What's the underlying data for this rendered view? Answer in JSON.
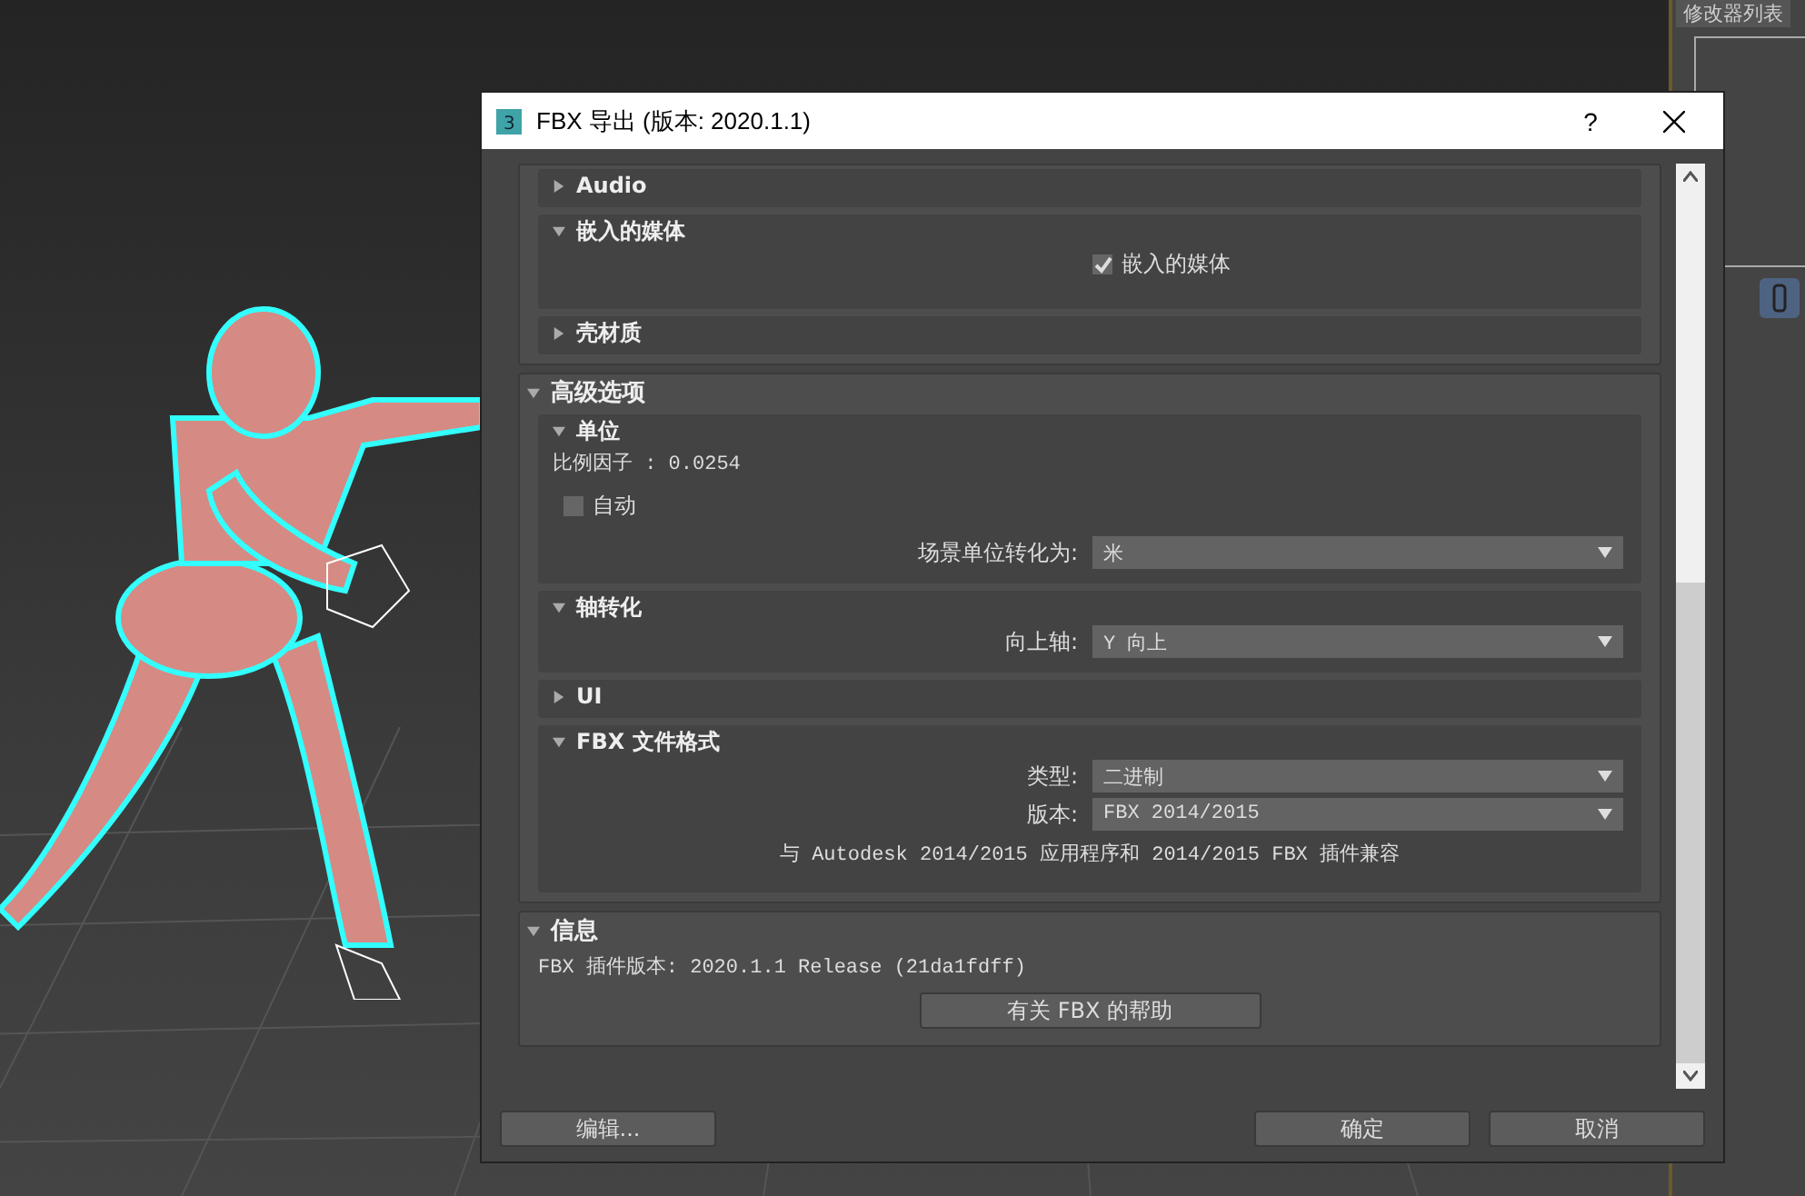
{
  "side_panel": {
    "title": "修改器列表"
  },
  "dialog": {
    "icon_text": "3",
    "title": "FBX 导出 (版本: 2020.1.1)",
    "help": "?"
  },
  "groups": [
    {
      "rollouts": [
        {
          "title": "Audio",
          "expanded": false
        },
        {
          "title": "嵌入的媒体",
          "expanded": true,
          "rows": [
            {
              "kind": "checkbox_field",
              "label": "嵌入的媒体",
              "checked": true
            }
          ]
        },
        {
          "title": "壳材质",
          "expanded": false
        }
      ]
    },
    {
      "title": "高级选项",
      "expanded": true,
      "rollouts": [
        {
          "title": "单位",
          "expanded": true,
          "rows": [
            {
              "kind": "text",
              "text": "比例因子 : 0.0254"
            },
            {
              "kind": "checkbox",
              "label": "自动",
              "checked": false
            },
            {
              "kind": "dropdown",
              "label": "场景单位转化为:",
              "value": "米"
            }
          ]
        },
        {
          "title": "轴转化",
          "expanded": true,
          "rows": [
            {
              "kind": "dropdown",
              "label": "向上轴:",
              "value": "Y 向上"
            }
          ]
        },
        {
          "title": "UI",
          "expanded": false
        },
        {
          "title": "FBX 文件格式",
          "expanded": true,
          "rows": [
            {
              "kind": "dropdown",
              "label": "类型:",
              "value": "二进制"
            },
            {
              "kind": "dropdown",
              "label": "版本:",
              "value": "FBX 2014/2015"
            },
            {
              "kind": "note",
              "text": "与 Autodesk 2014/2015 应用程序和 2014/2015 FBX 插件兼容"
            }
          ]
        }
      ]
    },
    {
      "title": "信息",
      "expanded": true,
      "rows": [
        {
          "kind": "text",
          "text": "FBX 插件版本: 2020.1.1 Release (21da1fdff)"
        },
        {
          "kind": "button",
          "label": "有关 FBX 的帮助"
        }
      ]
    }
  ],
  "footer": {
    "left": [
      "编辑..."
    ],
    "right": [
      "确定",
      "取消"
    ]
  }
}
